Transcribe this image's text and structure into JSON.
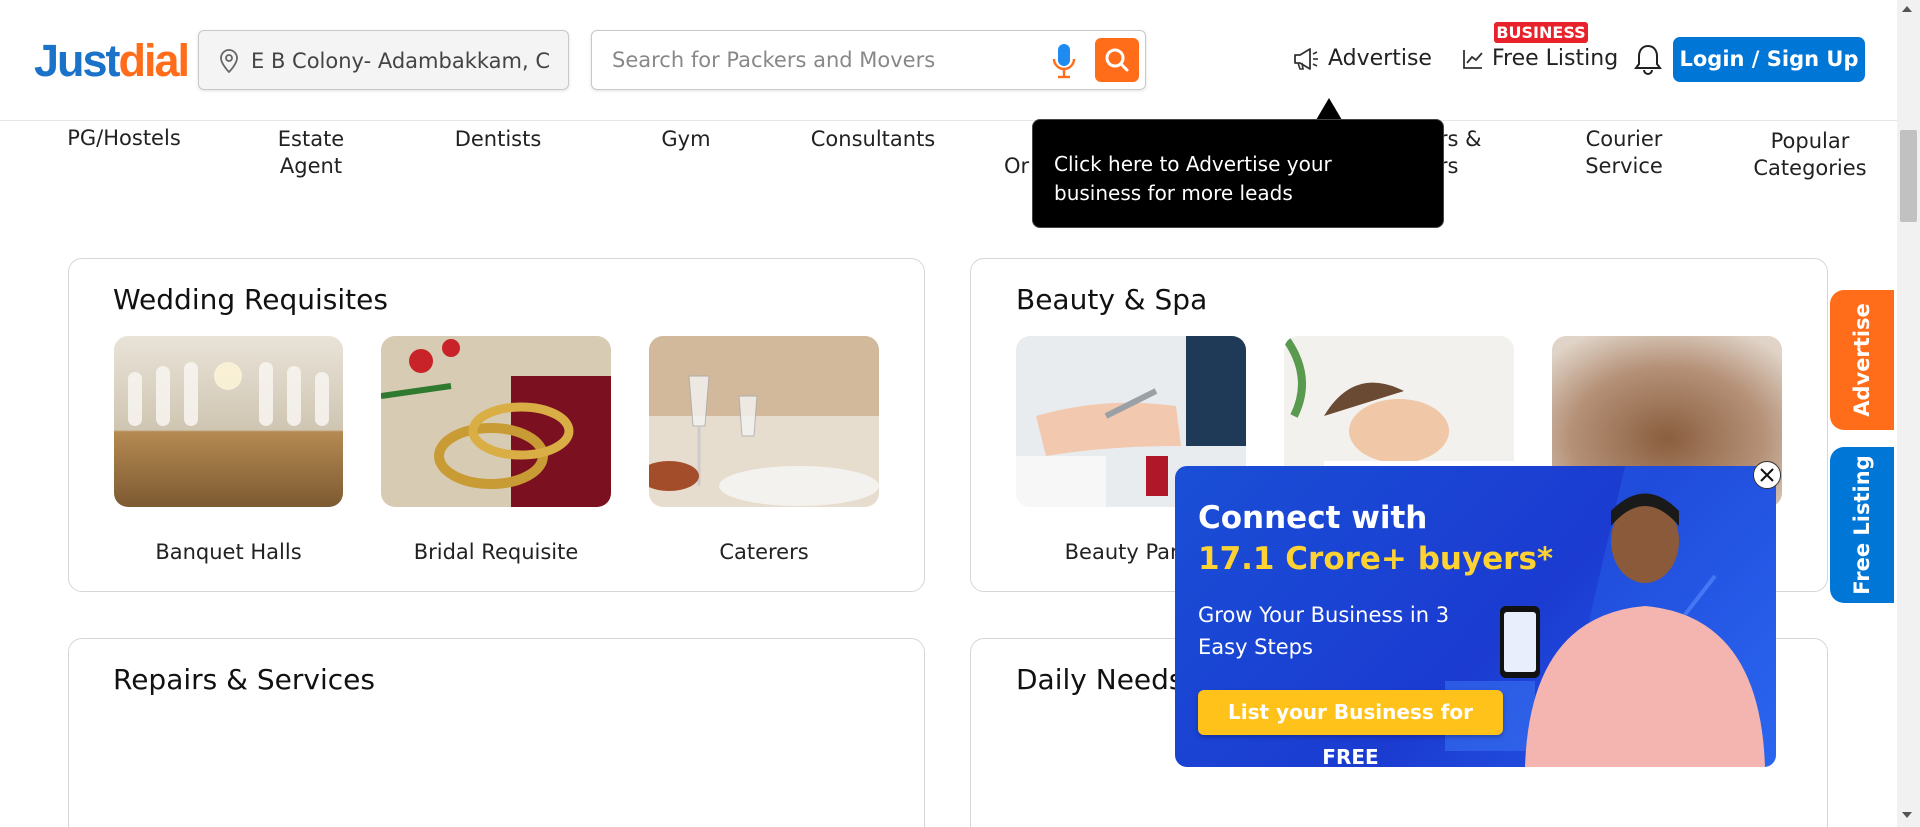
{
  "brand": {
    "logo_part1": "Just",
    "logo_part2": "dial"
  },
  "header": {
    "location_value": "E B Colony- Adambakkam, Chennai",
    "search_placeholder": "Search for Packers and Movers",
    "advertise_label": "Advertise",
    "free_listing_label": "Free Listing",
    "business_badge": "BUSINESS",
    "login_label": "Login / Sign Up"
  },
  "categories": [
    {
      "label": "PG/Hostels"
    },
    {
      "label": "Estate Agent"
    },
    {
      "label": "Dentists"
    },
    {
      "label": "Gym"
    },
    {
      "label": "Consultants"
    },
    {
      "label": "Or"
    },
    {
      "label": "ers & ers"
    },
    {
      "label": "Courier Service"
    },
    {
      "label": "Popular Categories"
    }
  ],
  "tooltip": {
    "text": "Click here to Advertise your business for more leads"
  },
  "sections": {
    "wedding": {
      "title": "Wedding Requisites",
      "items": [
        {
          "label": "Banquet Halls"
        },
        {
          "label": "Bridal Requisite"
        },
        {
          "label": "Caterers"
        }
      ]
    },
    "beauty": {
      "title": "Beauty & Spa",
      "items": [
        {
          "label": "Beauty Parlo"
        }
      ]
    },
    "repairs": {
      "title": "Repairs & Services"
    },
    "daily": {
      "title": "Daily Needs"
    }
  },
  "side_tabs": {
    "advertise": "Advertise",
    "free_listing": "Free Listing"
  },
  "popup": {
    "heading_line1": "Connect with",
    "heading_line2": "17.1 Crore+ buyers*",
    "subtext": "Grow Your Business in 3 Easy Steps",
    "cta": "List your Business for FREE"
  },
  "colors": {
    "brand_blue": "#0076d7",
    "brand_orange": "#ff6d1b",
    "badge_red": "#e8212a",
    "popup_yellow": "#ffd233"
  }
}
